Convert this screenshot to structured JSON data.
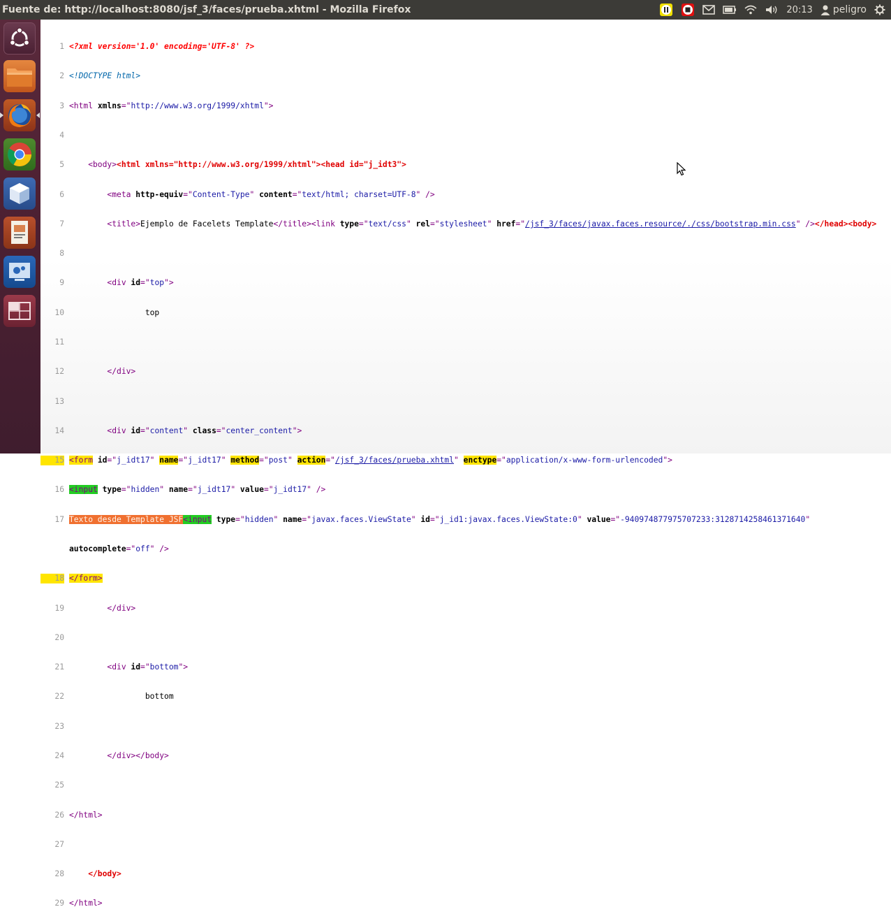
{
  "window": {
    "title": "Fuente de: http://localhost:8080/jsf_3/faces/prueba.xhtml - Mozilla Firefox"
  },
  "tray": {
    "clock": "20:13",
    "user": "peligro",
    "icons": [
      "pause-record-icon",
      "stop-record-icon",
      "mail-icon",
      "battery-icon",
      "wifi-icon",
      "volume-icon",
      "user-icon",
      "settings-gear-icon"
    ]
  },
  "launcher": {
    "items": [
      "ubuntu-dash-icon",
      "files-icon",
      "firefox-icon",
      "chrome-icon",
      "virtualbox-icon",
      "impress-icon",
      "screen-recorder-icon",
      "workspace-switcher-icon"
    ]
  },
  "source": {
    "line_numbers": [
      "1",
      "2",
      "3",
      "4",
      "5",
      "6",
      "7",
      "8",
      "9",
      "10",
      "11",
      "12",
      "13",
      "14",
      "15",
      "16",
      "17",
      "18",
      "19",
      "20",
      "21",
      "22",
      "23",
      "24",
      "25",
      "26",
      "27",
      "28",
      "29"
    ],
    "l1": "<?xml version='1.0' encoding='UTF-8' ?>",
    "l2": "<!DOCTYPE html>",
    "l3": {
      "a": "<html ",
      "b": "xmlns",
      "c": "=\"",
      "d": "http://www.w3.org/1999/xhtml",
      "e": "\">"
    },
    "l5": {
      "a": "    <body>",
      "b": "<html xmlns=\"http://www.w3.org/1999/xhtml\"><head id=\"j_idt3\">"
    },
    "l6": {
      "a": "        <meta ",
      "b": "http-equiv",
      "c": "=\"",
      "d": "Content-Type",
      "e": "\" ",
      "f": "content",
      "g": "=\"",
      "h": "text/html; charset=UTF-8",
      "i": "\" />"
    },
    "l7": {
      "a": "        <title>",
      "b": "Ejemplo de Facelets Template",
      "c": "</title><link ",
      "d": "type",
      "e": "=\"",
      "f": "text/css",
      "g": "\" ",
      "h": "rel",
      "i": "=\"",
      "j": "stylesheet",
      "k": "\" ",
      "l": "href",
      "m": "=\"",
      "n": "/jsf_3/faces/javax.faces.resource/./css/bootstrap.min.css",
      "o": "\" />",
      "p": "</head><body>"
    },
    "l9": {
      "a": "        <div ",
      "b": "id",
      "c": "=\"",
      "d": "top",
      "e": "\">"
    },
    "l10": "                top",
    "l12": "        </div>",
    "l14": {
      "a": "        <div ",
      "b": "id",
      "c": "=\"",
      "d": "content",
      "e": "\" ",
      "f": "class",
      "g": "=\"",
      "h": "center_content",
      "i": "\">"
    },
    "l15": {
      "a": "<form",
      "b": " ",
      "c": "id",
      "d": "=\"",
      "e": "j_idt17",
      "f": "\" ",
      "g": "name",
      "h": "=\"",
      "i": "j_idt17",
      "j": "\" ",
      "k": "method",
      "l": "=\"",
      "m": "post",
      "n": "\" ",
      "o": "action",
      "p": "=\"",
      "q": "/jsf_3/faces/prueba.xhtml",
      "r": "\" ",
      "s": "enctype",
      "t": "=\"",
      "u": "application/x-www-form-urlencoded",
      "v": "\">"
    },
    "l16": {
      "a": "<input",
      "b": " ",
      "c": "type",
      "d": "=\"",
      "e": "hidden",
      "f": "\" ",
      "g": "name",
      "h": "=\"",
      "i": "j_idt17",
      "j": "\" ",
      "k": "value",
      "l": "=\"",
      "m": "j_idt17",
      "n": "\" />"
    },
    "l17": {
      "a": "Texto desde Template JSF",
      "b": "<input",
      "c": " ",
      "d": "type",
      "e": "=\"",
      "f": "hidden",
      "g": "\" ",
      "h": "name",
      "i": "=\"",
      "j": "javax.faces.ViewState",
      "k": "\" ",
      "l": "id",
      "m": "=\"",
      "n": "j_id1:javax.faces.ViewState:0",
      "o": "\" ",
      "p": "value",
      "q": "=\"",
      "r": "-9409748779757072​33:3128714258461371640",
      "s": "\""
    },
    "l17b": {
      "a": "autocomplete",
      "b": "=\"",
      "c": "off",
      "d": "\" />"
    },
    "l18": "</form>",
    "l19": "        </div>",
    "l21": {
      "a": "        <div ",
      "b": "id",
      "c": "=\"",
      "d": "bottom",
      "e": "\">"
    },
    "l22": "                bottom",
    "l24": "        </div></body>",
    "l26": "</html>",
    "l28": "    </body>",
    "l29": "</html>"
  }
}
